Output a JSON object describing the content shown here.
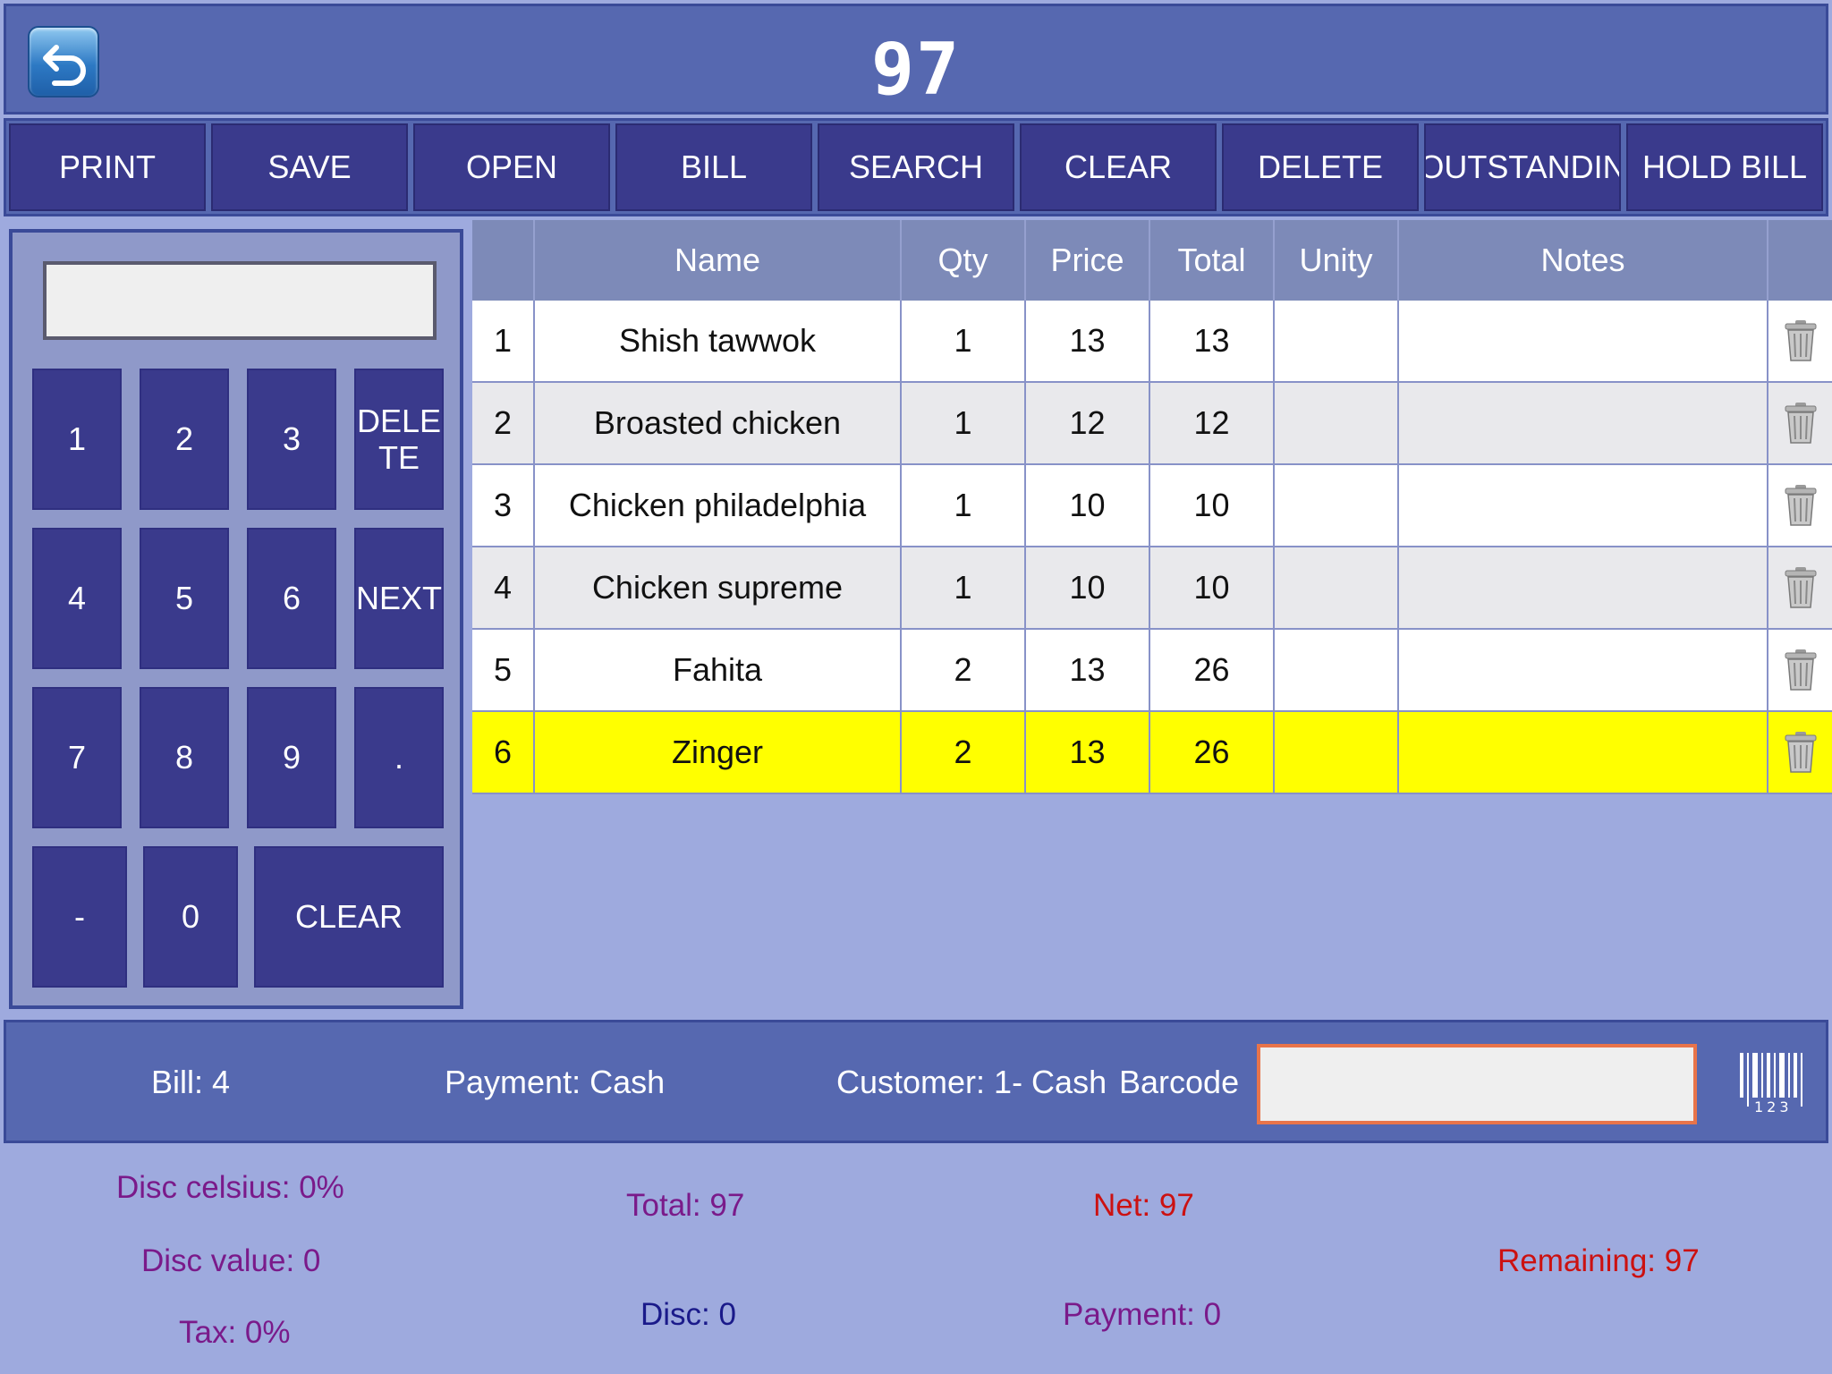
{
  "header": {
    "title": "97"
  },
  "toolbar": {
    "buttons": [
      "PRINT",
      "SAVE",
      "OPEN",
      "BILL",
      "SEARCH",
      "CLEAR",
      "DELETE",
      "OUTSTANDIN",
      "HOLD BILL"
    ]
  },
  "keypad": {
    "display_value": "",
    "keys": [
      "1",
      "2",
      "3",
      "DELE\nTE",
      "4",
      "5",
      "6",
      "NEXT",
      "7",
      "8",
      "9",
      ".",
      "-",
      "0",
      "CLEAR"
    ]
  },
  "table": {
    "columns": [
      "",
      "Name",
      "Qty",
      "Price",
      "Total",
      "Unity",
      "Notes",
      ""
    ],
    "rows": [
      {
        "no": "1",
        "name": "Shish tawwok",
        "qty": "1",
        "price": "13",
        "total": "13",
        "unity": "",
        "notes": "",
        "highlight": false
      },
      {
        "no": "2",
        "name": "Broasted chicken",
        "qty": "1",
        "price": "12",
        "total": "12",
        "unity": "",
        "notes": "",
        "highlight": false
      },
      {
        "no": "3",
        "name": "Chicken philadelphia",
        "qty": "1",
        "price": "10",
        "total": "10",
        "unity": "",
        "notes": "",
        "highlight": false
      },
      {
        "no": "4",
        "name": "Chicken supreme",
        "qty": "1",
        "price": "10",
        "total": "10",
        "unity": "",
        "notes": "",
        "highlight": false
      },
      {
        "no": "5",
        "name": "Fahita",
        "qty": "2",
        "price": "13",
        "total": "26",
        "unity": "",
        "notes": "",
        "highlight": false
      },
      {
        "no": "6",
        "name": "Zinger",
        "qty": "2",
        "price": "13",
        "total": "26",
        "unity": "",
        "notes": "",
        "highlight": true
      }
    ],
    "row_colors": {
      "odd": "#ffffff",
      "even": "#e9e9ec",
      "highlight": "#ffff00"
    }
  },
  "info": {
    "bill": "Bill: 4",
    "payment": "Payment: Cash",
    "customer": "Customer: 1- Cash",
    "barcode_label": "Barcode",
    "barcode_value": "",
    "barcode_icon_digits": "123"
  },
  "summary": {
    "disc_celsius": "Disc celsius: 0%",
    "disc_value": "Disc value: 0",
    "tax": "Tax: 0%",
    "total": "Total: 97",
    "disc": "Disc: 0",
    "net": "Net: 97",
    "payment": "Payment: 0",
    "remaining": "Remaining: 97"
  }
}
